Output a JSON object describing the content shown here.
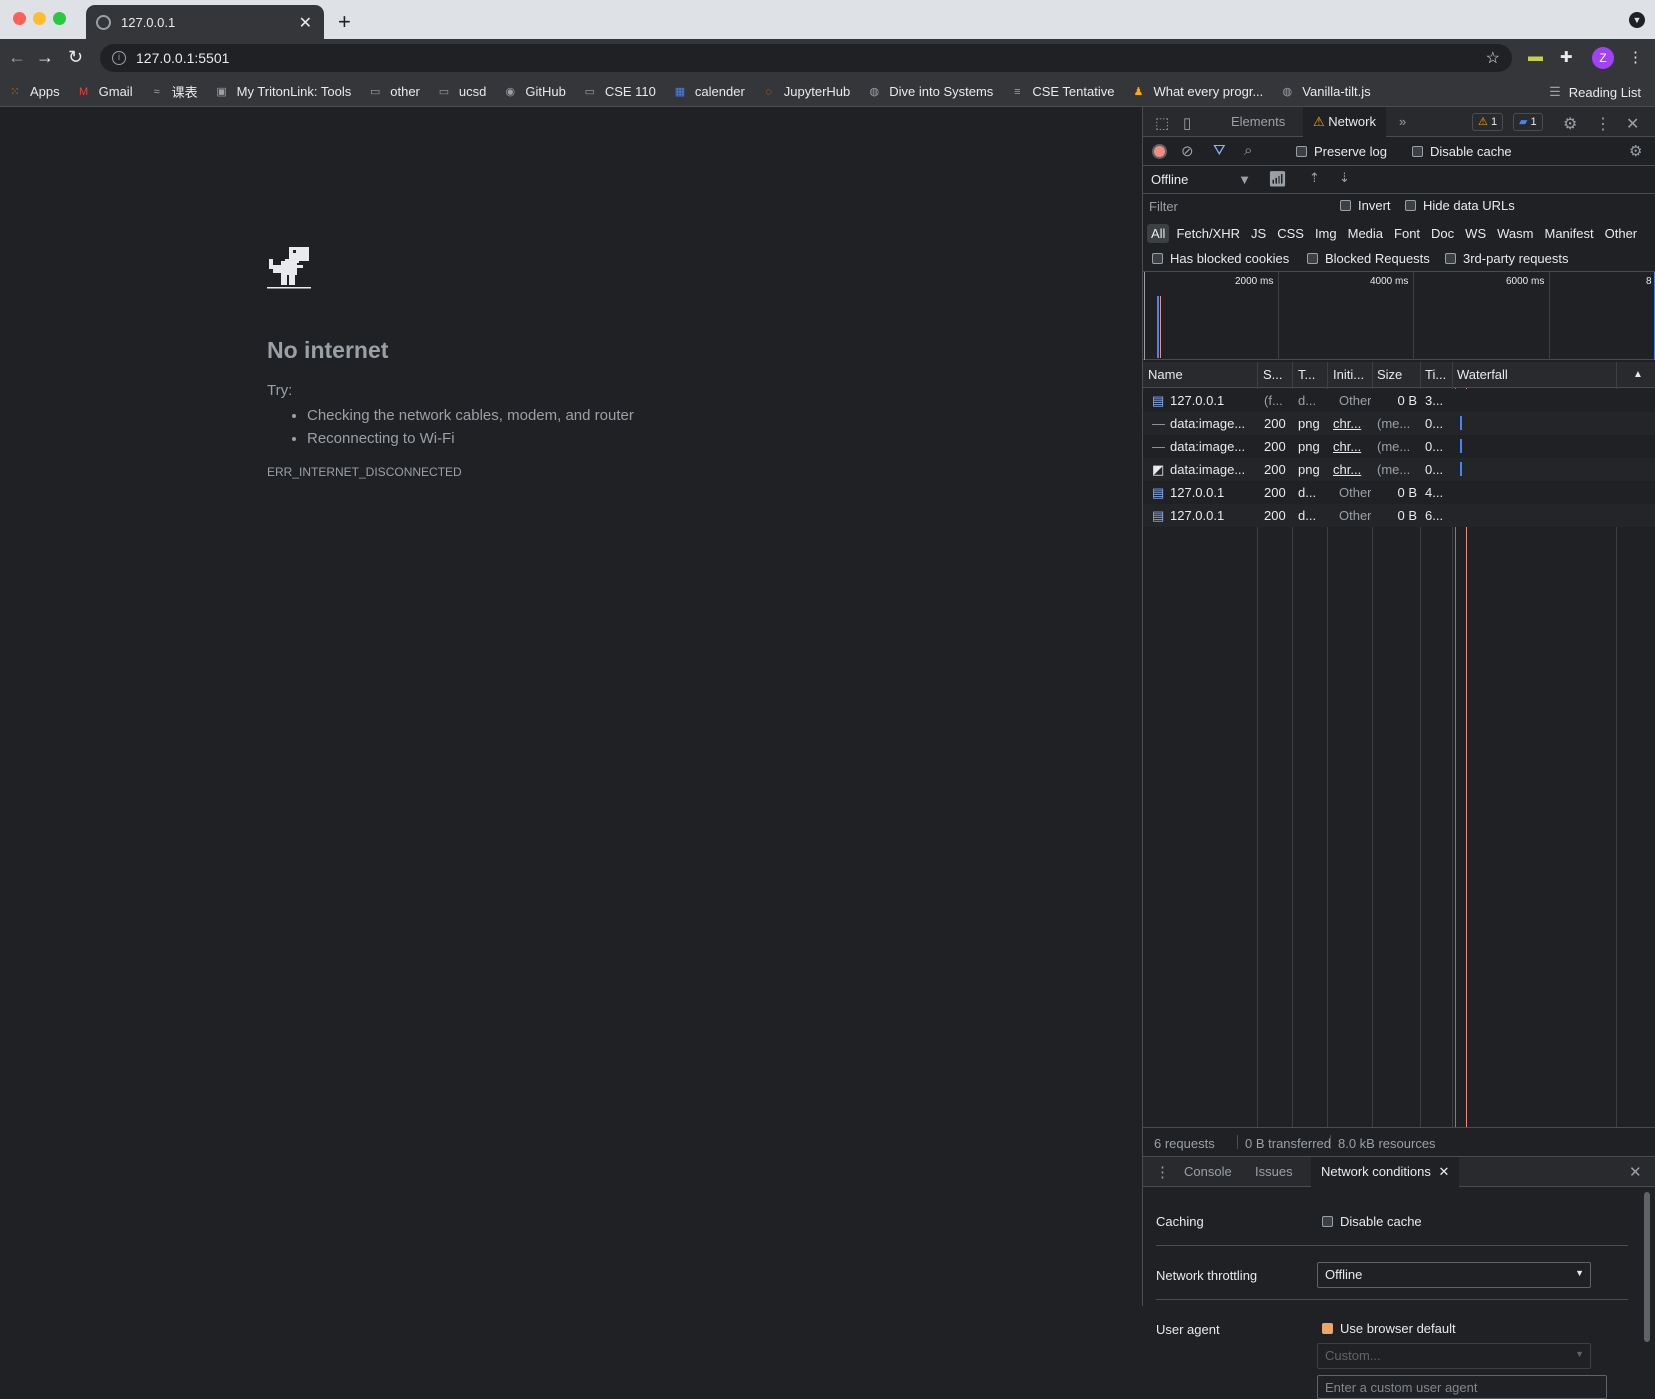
{
  "browser": {
    "tab_title": "127.0.0.1",
    "url": "127.0.0.1:5501",
    "avatar_letter": "Z",
    "bookmarks": [
      "Apps",
      "Gmail",
      "课表",
      "My TritonLink: Tools",
      "other",
      "ucsd",
      "GitHub",
      "CSE 110",
      "calender",
      "JupyterHub",
      "Dive into Systems",
      "CSE Tentative",
      "What every progr...",
      "Vanilla-tilt.js"
    ],
    "reading_list": "Reading List"
  },
  "error_page": {
    "title": "No internet",
    "try_label": "Try:",
    "suggestions": [
      "Checking the network cables, modem, and router",
      "Reconnecting to Wi-Fi"
    ],
    "error_code": "ERR_INTERNET_DISCONNECTED"
  },
  "devtools": {
    "tabs": {
      "elements": "Elements",
      "network": "Network"
    },
    "warnings_count": "1",
    "messages_count": "1",
    "preserve_log": "Preserve log",
    "disable_cache": "Disable cache",
    "throttle": "Offline",
    "filter_placeholder": "Filter",
    "invert": "Invert",
    "hide_data_urls": "Hide data URLs",
    "filter_types": [
      "All",
      "Fetch/XHR",
      "JS",
      "CSS",
      "Img",
      "Media",
      "Font",
      "Doc",
      "WS",
      "Wasm",
      "Manifest",
      "Other"
    ],
    "has_blocked_cookies": "Has blocked cookies",
    "blocked_requests": "Blocked Requests",
    "third_party": "3rd-party requests",
    "timeline_ticks": [
      "2000 ms",
      "4000 ms",
      "6000 ms",
      "8"
    ],
    "columns": [
      "Name",
      "S...",
      "T...",
      "Initi...",
      "Size",
      "Ti...",
      "Waterfall"
    ],
    "rows": [
      {
        "name": "127.0.0.1",
        "status": "(f...",
        "type": "d...",
        "initiator": "Other",
        "size": "0 B",
        "time": "3..."
      },
      {
        "name": "data:image...",
        "status": "200",
        "type": "png",
        "initiator": "chr...",
        "size": "(me...",
        "time": "0..."
      },
      {
        "name": "data:image...",
        "status": "200",
        "type": "png",
        "initiator": "chr...",
        "size": "(me...",
        "time": "0..."
      },
      {
        "name": "data:image...",
        "status": "200",
        "type": "png",
        "initiator": "chr...",
        "size": "(me...",
        "time": "0..."
      },
      {
        "name": "127.0.0.1",
        "status": "200",
        "type": "d...",
        "initiator": "Other",
        "size": "0 B",
        "time": "4..."
      },
      {
        "name": "127.0.0.1",
        "status": "200",
        "type": "d...",
        "initiator": "Other",
        "size": "0 B",
        "time": "6..."
      }
    ],
    "summary": {
      "requests": "6 requests",
      "transferred": "0 B transferred",
      "resources": "8.0 kB resources"
    },
    "drawer_tabs": {
      "console": "Console",
      "issues": "Issues",
      "network_conditions": "Network conditions"
    },
    "network_conditions": {
      "caching_label": "Caching",
      "disable_cache": "Disable cache",
      "throttling_label": "Network throttling",
      "throttling_value": "Offline",
      "user_agent_label": "User agent",
      "use_browser_default": "Use browser default",
      "custom_placeholder": "Custom...",
      "custom_ua_placeholder": "Enter a custom user agent"
    }
  }
}
